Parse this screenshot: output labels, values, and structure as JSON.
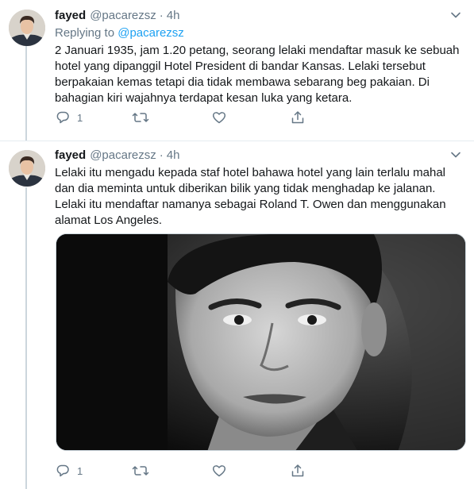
{
  "tweets": [
    {
      "display_name": "fayed",
      "handle": "@pacarezsz",
      "separator": "·",
      "time": "4h",
      "replying_prefix": "Replying to",
      "replying_to": "@pacarezsz",
      "text": "2 Januari 1935, jam 1.20 petang, seorang lelaki mendaftar masuk ke sebuah\nhotel yang dipanggil Hotel President di bandar Kansas. Lelaki tersebut\nberpakaian kemas tetapi dia tidak membawa sebarang beg pakaian. Di\nbahagian kiri wajahnya terdapat kesan luka yang ketara.",
      "reply_count": "1",
      "retweet_count": "",
      "like_count": ""
    },
    {
      "display_name": "fayed",
      "handle": "@pacarezsz",
      "separator": "·",
      "time": "4h",
      "text": "Lelaki itu mengadu kepada staf hotel bahawa hotel yang lain terlalu mahal\ndan dia meminta untuk diberikan bilik yang tidak menghadap ke jalanan.\nLelaki itu mendaftar namanya sebagai Roland T. Owen dan menggunakan\nalamat Los Angeles.",
      "reply_count": "1",
      "retweet_count": "",
      "like_count": ""
    }
  ],
  "icons": {
    "caret": "chevron-down-icon",
    "reply": "reply-icon",
    "retweet": "retweet-icon",
    "like": "heart-icon",
    "share": "share-icon"
  },
  "colors": {
    "text": "#14171a",
    "secondary": "#657786",
    "link": "#1da1f2",
    "border": "#e6ecf0",
    "thread_line": "#ccd6dd"
  }
}
